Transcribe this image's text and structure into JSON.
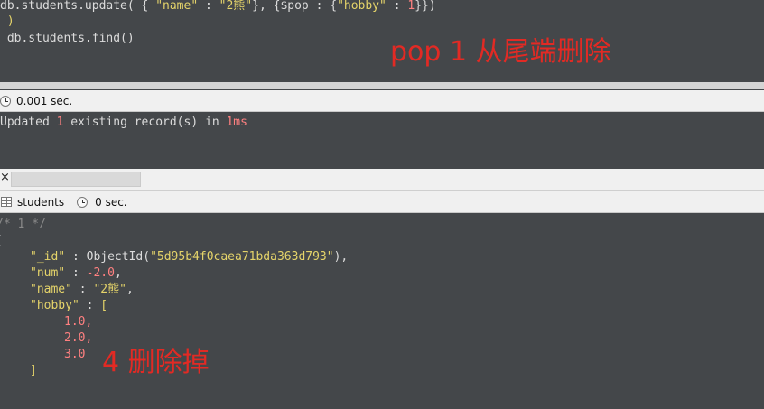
{
  "editor": {
    "line1": {
      "a": "db.students.update( {",
      "b": "\"name\"",
      "c": " : ",
      "d": "\"2熊\"",
      "e": "}, {",
      "f": "$pop",
      "g": " : {",
      "h": "\"hobby\"",
      "i": " : ",
      "j": "1",
      "k": "}})"
    },
    "line2": " )",
    "line3": " db.students.find()"
  },
  "annotations": {
    "top": "pop  1 从尾端删除",
    "bottom": "4 删除掉"
  },
  "status1": {
    "time": "0.001 sec."
  },
  "message": {
    "pre": "Updated ",
    "count": "1",
    "mid": " existing record(s) in ",
    "dur": "1ms"
  },
  "tabbar": {
    "close": "×"
  },
  "status2": {
    "collection": "students",
    "time": "0 sec."
  },
  "result": {
    "comment": "/* 1 */",
    "open_brace": "{",
    "id_key": "\"_id\"",
    "id_sep": " : ",
    "id_fn": "ObjectId(",
    "id_val": "\"5d95b4f0caea71bda363d793\"",
    "id_end": "),",
    "num_key": "\"num\"",
    "num_sep": " : ",
    "num_val": "-2.0",
    "num_end": ",",
    "name_key": "\"name\"",
    "name_sep": " : ",
    "name_val": "\"2熊\"",
    "name_end": ",",
    "hobby_key": "\"hobby\"",
    "hobby_sep": " : ",
    "hobby_open": "[",
    "hobby_items": [
      "1.0,",
      "2.0,",
      "3.0"
    ],
    "hobby_close": "]"
  },
  "colors": {
    "background": "#44474a",
    "annotation": "#e22a24",
    "string": "#e5d46a",
    "number": "#ff8080"
  }
}
